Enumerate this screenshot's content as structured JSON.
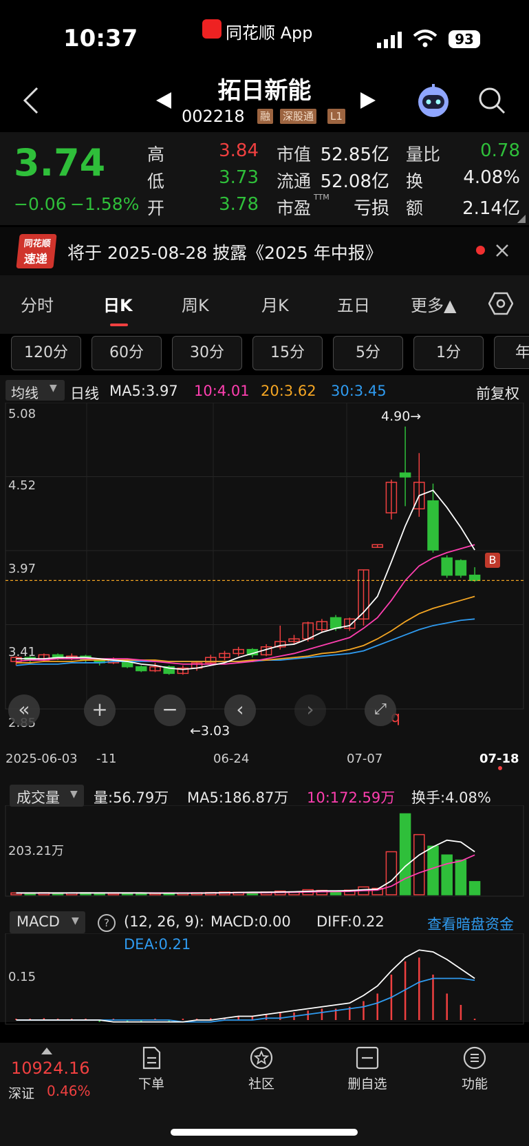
{
  "status": {
    "time": "10:37",
    "app": "同花顺 App",
    "battery": "93"
  },
  "header": {
    "name": "拓日新能",
    "code": "002218",
    "tags": [
      "融",
      "深股通",
      "L1"
    ]
  },
  "quote": {
    "price": "3.74",
    "change": "−0.06",
    "change_pct": "−1.58%",
    "high_label": "高",
    "high": "3.84",
    "low_label": "低",
    "low": "3.73",
    "open_label": "开",
    "open": "3.78",
    "mcap_label": "市值",
    "mcap": "52.85亿",
    "float_label": "流通",
    "float": "52.08亿",
    "pe_label": "市盈",
    "pe_sup": "TTM",
    "pe": "亏损",
    "vr_label": "量比",
    "vr": "0.78",
    "turn_label": "换",
    "turn": "4.08%",
    "amt_label": "额",
    "amt": "2.14亿"
  },
  "notice": {
    "logo_top": "同花顺",
    "logo_bottom": "速递",
    "text": "将于 2025-08-28 披露《2025 年中报》"
  },
  "tabs": [
    "分时",
    "日K",
    "周K",
    "月K",
    "五日",
    "更多▲"
  ],
  "periods": [
    "120分",
    "60分",
    "30分",
    "15分",
    "5分",
    "1分",
    "年"
  ],
  "kline": {
    "indicator": "均线",
    "period": "日线",
    "ma5": "MA5:3.97",
    "ma10": "10:4.01",
    "ma20": "20:3.62",
    "ma30": "30:3.45",
    "adjust": "前复权",
    "y_labels": [
      "5.08",
      "4.52",
      "3.97",
      "3.41",
      "2.85"
    ],
    "high_mark": "4.90→",
    "low_mark": "←3.03",
    "x_labels": [
      "2025-06-03",
      "-11",
      "06-24",
      "07-07",
      "07-18"
    ],
    "b_mark": "B",
    "q_mark": "q"
  },
  "volume": {
    "indicator": "成交量",
    "vol": "量:56.79万",
    "ma5": "MA5:186.87万",
    "ma10": "10:172.59万",
    "turnover": "换手:4.08%",
    "y_label": "203.21万"
  },
  "macd": {
    "indicator": "MACD",
    "params": "(12, 26, 9):",
    "macd": "MACD:0.00",
    "diff": "DIFF:0.22",
    "dea": "DEA:0.21",
    "link": "查看暗盘资金",
    "y_label": "0.15"
  },
  "nav": {
    "index_value": "10924.16",
    "index_name": "深证",
    "index_pct": "0.46%",
    "items": [
      "下单",
      "社区",
      "删自选",
      "功能"
    ]
  },
  "colors": {
    "up": "#f04040",
    "down": "#2fbf3a",
    "ma5": "#ffffff",
    "ma10": "#ff3fb0",
    "ma20": "#f5a623",
    "ma30": "#2f9bf0"
  },
  "chart_data": {
    "type": "candlestick",
    "candles": [
      {
        "o": 3.13,
        "c": 3.16,
        "h": 3.17,
        "l": 3.1
      },
      {
        "o": 3.16,
        "c": 3.14,
        "h": 3.18,
        "l": 3.12
      },
      {
        "o": 3.14,
        "c": 3.18,
        "h": 3.19,
        "l": 3.13
      },
      {
        "o": 3.18,
        "c": 3.15,
        "h": 3.19,
        "l": 3.14
      },
      {
        "o": 3.15,
        "c": 3.17,
        "h": 3.19,
        "l": 3.14
      },
      {
        "o": 3.17,
        "c": 3.14,
        "h": 3.18,
        "l": 3.12
      },
      {
        "o": 3.14,
        "c": 3.12,
        "h": 3.15,
        "l": 3.1
      },
      {
        "o": 3.12,
        "c": 3.14,
        "h": 3.16,
        "l": 3.11
      },
      {
        "o": 3.14,
        "c": 3.09,
        "h": 3.15,
        "l": 3.08
      },
      {
        "o": 3.09,
        "c": 3.06,
        "h": 3.1,
        "l": 3.05
      },
      {
        "o": 3.06,
        "c": 3.09,
        "h": 3.12,
        "l": 3.05
      },
      {
        "o": 3.09,
        "c": 3.04,
        "h": 3.1,
        "l": 3.03
      },
      {
        "o": 3.04,
        "c": 3.08,
        "h": 3.1,
        "l": 3.03
      },
      {
        "o": 3.08,
        "c": 3.12,
        "h": 3.13,
        "l": 3.06
      },
      {
        "o": 3.12,
        "c": 3.16,
        "h": 3.18,
        "l": 3.11
      },
      {
        "o": 3.16,
        "c": 3.19,
        "h": 3.21,
        "l": 3.14
      },
      {
        "o": 3.19,
        "c": 3.22,
        "h": 3.24,
        "l": 3.17
      },
      {
        "o": 3.22,
        "c": 3.18,
        "h": 3.23,
        "l": 3.16
      },
      {
        "o": 3.18,
        "c": 3.24,
        "h": 3.26,
        "l": 3.17
      },
      {
        "o": 3.24,
        "c": 3.28,
        "h": 3.4,
        "l": 3.22
      },
      {
        "o": 3.28,
        "c": 3.3,
        "h": 3.33,
        "l": 3.26
      },
      {
        "o": 3.3,
        "c": 3.42,
        "h": 3.43,
        "l": 3.28
      },
      {
        "o": 3.37,
        "c": 3.43,
        "h": 3.45,
        "l": 3.35
      },
      {
        "o": 3.46,
        "c": 3.38,
        "h": 3.48,
        "l": 3.36
      },
      {
        "o": 3.38,
        "c": 3.45,
        "h": 3.46,
        "l": 3.36
      },
      {
        "o": 3.45,
        "c": 3.82,
        "h": 3.82,
        "l": 3.4
      },
      {
        "o": 3.99,
        "c": 4.01,
        "h": 4.01,
        "l": 3.99
      },
      {
        "o": 4.25,
        "c": 4.48,
        "h": 4.5,
        "l": 4.2
      },
      {
        "o": 4.55,
        "c": 4.52,
        "h": 4.9,
        "l": 4.3
      },
      {
        "o": 4.28,
        "c": 4.48,
        "h": 4.7,
        "l": 4.22
      },
      {
        "o": 4.34,
        "c": 3.97,
        "h": 4.47,
        "l": 3.95
      },
      {
        "o": 3.91,
        "c": 3.78,
        "h": 3.93,
        "l": 3.76
      },
      {
        "o": 3.89,
        "c": 3.78,
        "h": 3.9,
        "l": 3.76
      },
      {
        "o": 3.78,
        "c": 3.74,
        "h": 3.84,
        "l": 3.73
      }
    ],
    "ma5": [
      3.15,
      3.15,
      3.15,
      3.16,
      3.16,
      3.16,
      3.15,
      3.14,
      3.13,
      3.11,
      3.1,
      3.08,
      3.07,
      3.08,
      3.1,
      3.12,
      3.16,
      3.19,
      3.22,
      3.25,
      3.26,
      3.3,
      3.35,
      3.38,
      3.4,
      3.5,
      3.62,
      3.88,
      4.15,
      4.38,
      4.42,
      4.29,
      4.14,
      3.97
    ],
    "ma10": [
      3.13,
      3.14,
      3.14,
      3.15,
      3.15,
      3.15,
      3.15,
      3.15,
      3.15,
      3.14,
      3.13,
      3.12,
      3.11,
      3.11,
      3.11,
      3.11,
      3.12,
      3.13,
      3.15,
      3.17,
      3.19,
      3.22,
      3.25,
      3.28,
      3.31,
      3.38,
      3.46,
      3.59,
      3.74,
      3.85,
      3.91,
      3.95,
      3.98,
      4.01
    ],
    "ma20": [
      3.12,
      3.12,
      3.13,
      3.13,
      3.13,
      3.14,
      3.14,
      3.14,
      3.14,
      3.14,
      3.14,
      3.13,
      3.13,
      3.13,
      3.13,
      3.13,
      3.13,
      3.14,
      3.14,
      3.15,
      3.16,
      3.17,
      3.19,
      3.2,
      3.22,
      3.25,
      3.3,
      3.36,
      3.43,
      3.49,
      3.53,
      3.56,
      3.59,
      3.62
    ],
    "ma30": [
      3.1,
      3.11,
      3.11,
      3.11,
      3.12,
      3.12,
      3.12,
      3.13,
      3.13,
      3.13,
      3.13,
      3.13,
      3.13,
      3.13,
      3.13,
      3.13,
      3.13,
      3.13,
      3.14,
      3.14,
      3.15,
      3.16,
      3.17,
      3.18,
      3.19,
      3.21,
      3.25,
      3.29,
      3.33,
      3.37,
      3.4,
      3.42,
      3.44,
      3.45
    ],
    "volume": [
      8,
      7,
      9,
      7,
      8,
      9,
      7,
      6,
      8,
      7,
      6,
      8,
      7,
      9,
      10,
      12,
      11,
      9,
      12,
      16,
      13,
      22,
      19,
      16,
      20,
      34,
      28,
      186,
      350,
      260,
      210,
      172,
      150,
      57
    ],
    "vol_ma5": [
      8,
      8,
      8,
      8,
      8,
      8,
      8,
      8,
      8,
      8,
      7,
      7,
      7,
      7,
      8,
      9,
      10,
      11,
      11,
      12,
      13,
      15,
      17,
      17,
      18,
      22,
      24,
      60,
      123,
      172,
      207,
      236,
      228,
      186
    ],
    "vol_ma10": [
      7,
      7,
      7,
      7,
      8,
      8,
      8,
      8,
      8,
      8,
      8,
      8,
      8,
      8,
      8,
      8,
      9,
      9,
      9,
      10,
      11,
      12,
      13,
      14,
      15,
      18,
      20,
      37,
      70,
      95,
      115,
      134,
      146,
      172
    ],
    "macd_bar": [
      0.0,
      0.0,
      0.01,
      0.0,
      0.0,
      0.0,
      -0.01,
      0.0,
      -0.01,
      -0.01,
      0.0,
      -0.01,
      0.0,
      0.0,
      0.01,
      0.01,
      0.02,
      0.02,
      0.03,
      0.04,
      0.04,
      0.05,
      0.06,
      0.06,
      0.07,
      0.1,
      0.14,
      0.24,
      0.31,
      0.33,
      0.24,
      0.14,
      0.08,
      0.0
    ],
    "diff": [
      0.0,
      0.0,
      0.0,
      0.0,
      0.0,
      0.0,
      0.0,
      -0.01,
      -0.01,
      -0.01,
      -0.01,
      -0.01,
      -0.01,
      0.0,
      0.0,
      0.01,
      0.02,
      0.02,
      0.03,
      0.04,
      0.05,
      0.06,
      0.07,
      0.08,
      0.09,
      0.13,
      0.18,
      0.26,
      0.33,
      0.37,
      0.36,
      0.32,
      0.27,
      0.22
    ],
    "dea": [
      0.0,
      0.0,
      0.0,
      0.0,
      0.0,
      0.0,
      0.0,
      0.0,
      0.0,
      0.0,
      0.0,
      0.0,
      -0.01,
      -0.01,
      -0.01,
      0.0,
      0.0,
      0.0,
      0.01,
      0.01,
      0.02,
      0.03,
      0.04,
      0.05,
      0.06,
      0.07,
      0.09,
      0.12,
      0.16,
      0.2,
      0.22,
      0.22,
      0.22,
      0.21
    ],
    "price_ylim": [
      2.85,
      5.08
    ],
    "last_price": 3.74
  }
}
